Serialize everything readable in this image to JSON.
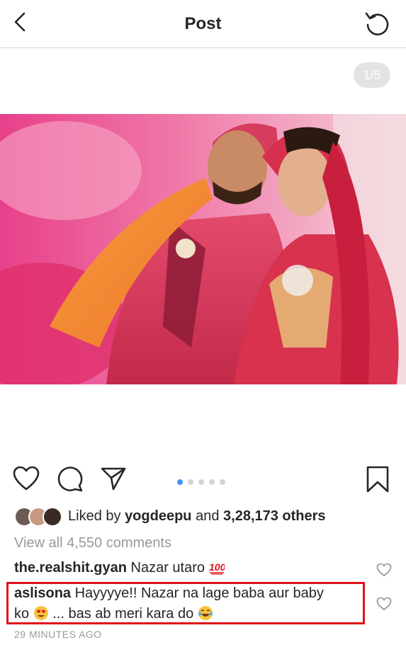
{
  "header": {
    "title": "Post"
  },
  "carousel": {
    "counter": "1/5",
    "dot_count": 5,
    "active_index": 0
  },
  "likes": {
    "prefix": "Liked by",
    "user": "yogdeepu",
    "middle": "and",
    "count": "3,28,173 others"
  },
  "view_all_comments": "View all 4,550 comments",
  "comments": [
    {
      "user": "the.realshit.gyan",
      "text": "Nazar utaro",
      "emoji": "100-emoji"
    },
    {
      "user": "aslisona",
      "text_part1": "Hayyyye!! Nazar na lage baba aur baby",
      "text_part2": "ko",
      "emoji1": "heart-eyes-emoji",
      "text_part3": "... bas ab meri kara do",
      "emoji2": "tears-of-joy-emoji"
    }
  ],
  "timestamp": "29 MINUTES AGO",
  "colors": {
    "accent_blue": "#3897f0",
    "highlight_red": "#e0131b",
    "muted_gray": "#999999"
  }
}
